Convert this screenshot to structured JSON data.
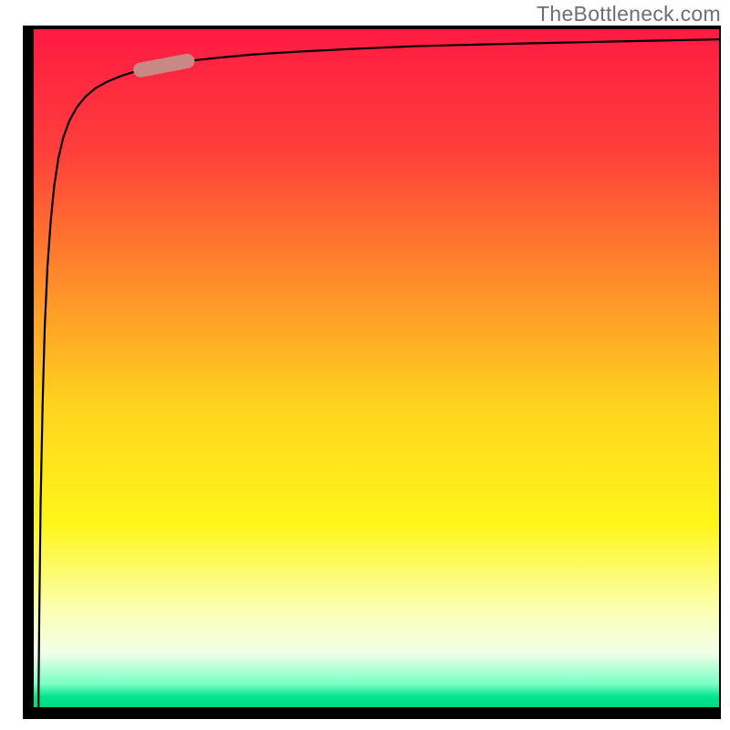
{
  "watermark": "TheBottleneck.com",
  "chart_data": {
    "type": "line",
    "title": "",
    "xlabel": "",
    "ylabel": "",
    "x_range": [
      0,
      100
    ],
    "y_range": [
      0,
      100
    ],
    "curve": {
      "x": [
        0.7,
        0.8,
        1.0,
        1.3,
        1.6,
        2.0,
        2.5,
        3.0,
        3.6,
        4.3,
        5.2,
        6.3,
        7.5,
        9.0,
        10.8,
        13.0,
        15.6,
        18.7,
        22.4,
        27.0,
        32.3,
        38.8,
        46.6,
        55.9,
        67.1,
        80.5,
        100.0
      ],
      "y": [
        2.0,
        13.0,
        30.0,
        45.0,
        56.0,
        65.0,
        72.0,
        77.0,
        81.0,
        84.0,
        86.5,
        88.5,
        90.0,
        91.3,
        92.3,
        93.2,
        94.0,
        94.7,
        95.3,
        95.8,
        96.3,
        96.7,
        97.1,
        97.5,
        97.8,
        98.1,
        98.5
      ]
    },
    "highlight_segment": {
      "x": [
        15.6,
        22.4
      ],
      "y": [
        94.0,
        95.3
      ]
    },
    "gradient_stops": [
      {
        "offset": 0.0,
        "color": "#ff1a43"
      },
      {
        "offset": 0.18,
        "color": "#ff3f3b"
      },
      {
        "offset": 0.37,
        "color": "#ff8b2b"
      },
      {
        "offset": 0.55,
        "color": "#ffd21f"
      },
      {
        "offset": 0.73,
        "color": "#fff61a"
      },
      {
        "offset": 0.86,
        "color": "#fbffb7"
      },
      {
        "offset": 0.92,
        "color": "#f1ffe8"
      },
      {
        "offset": 0.965,
        "color": "#7cffc5"
      },
      {
        "offset": 0.985,
        "color": "#00e58f"
      },
      {
        "offset": 1.0,
        "color": "#00d884"
      }
    ],
    "frame_color": "#000000",
    "curve_color": "#000000",
    "highlight_color": "#c88884"
  }
}
